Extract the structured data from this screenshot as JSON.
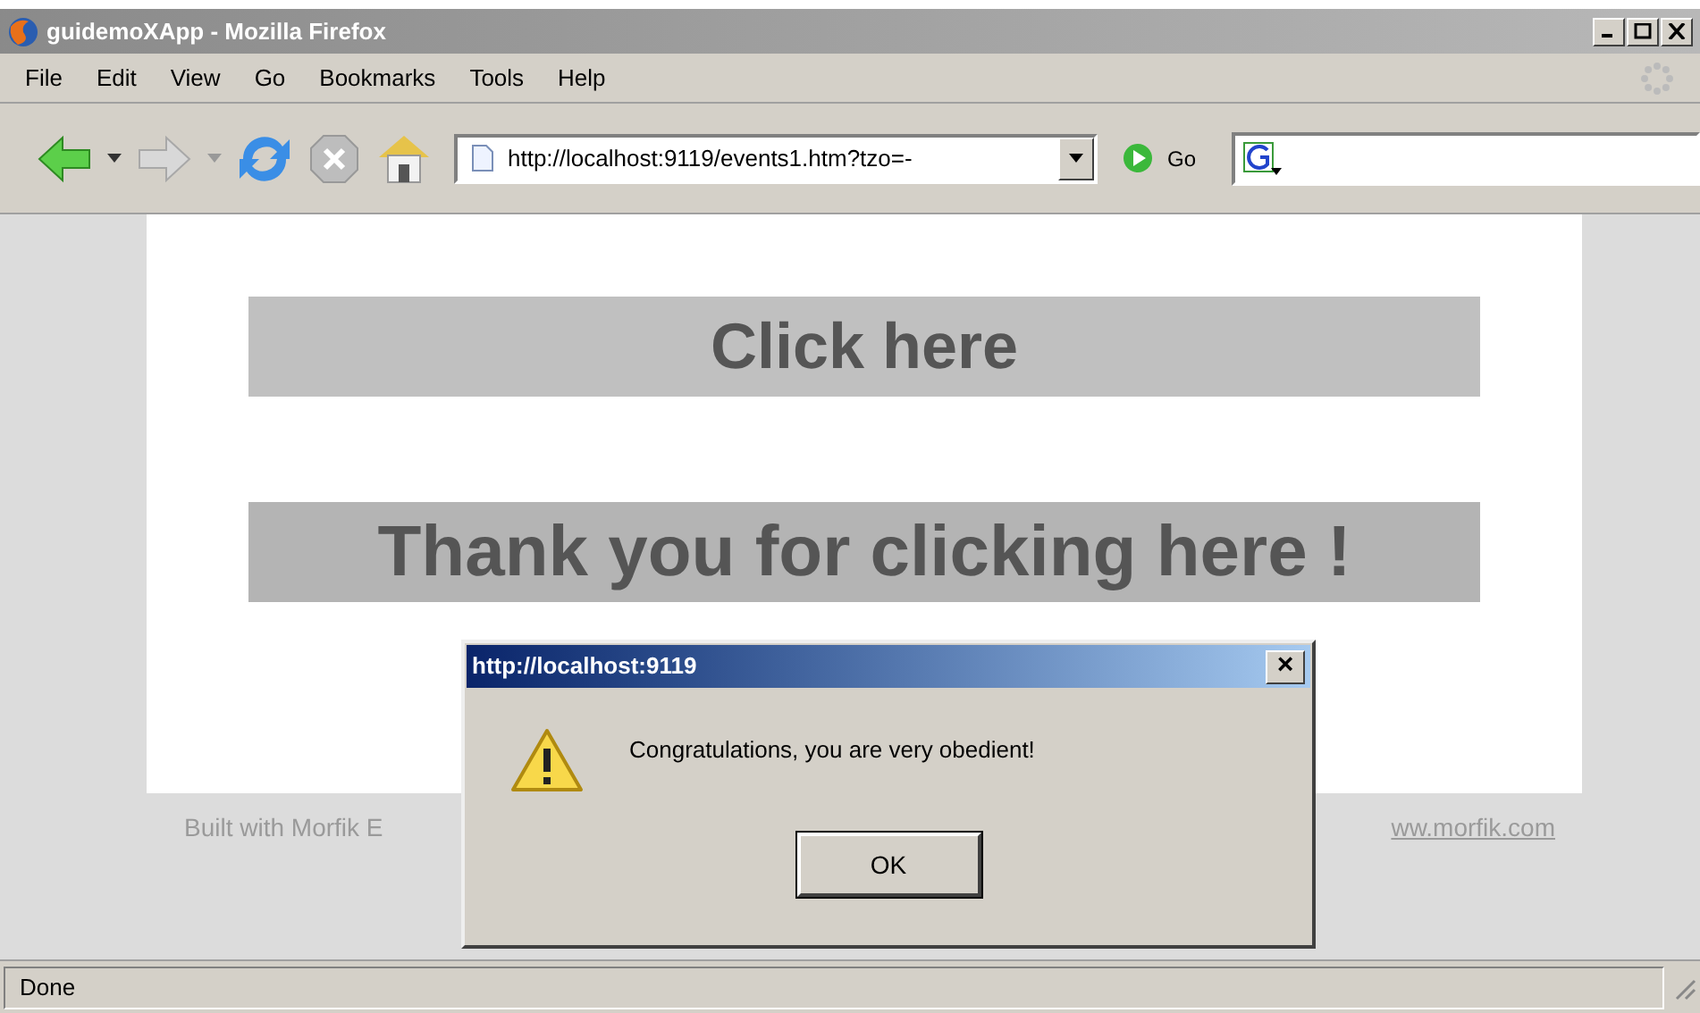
{
  "window": {
    "title": "guidemoXApp - Mozilla Firefox"
  },
  "menu": [
    "File",
    "Edit",
    "View",
    "Go",
    "Bookmarks",
    "Tools",
    "Help"
  ],
  "toolbar": {
    "address": "http://localhost:9119/events1.htm?tzo=-",
    "go": "Go"
  },
  "page": {
    "headings": [
      {
        "text": "Click here",
        "kind": "button"
      },
      {
        "text": "Thank you for clicking here !",
        "kind": "message"
      }
    ],
    "footer": {
      "text": "Built with Morfik E",
      "link": "ww.morfik.com"
    }
  },
  "dialog": {
    "title": "http://localhost:9119",
    "message": "Congratulations, you are very obedient!",
    "button": "OK",
    "close": "×"
  },
  "status_bar": "Done"
}
